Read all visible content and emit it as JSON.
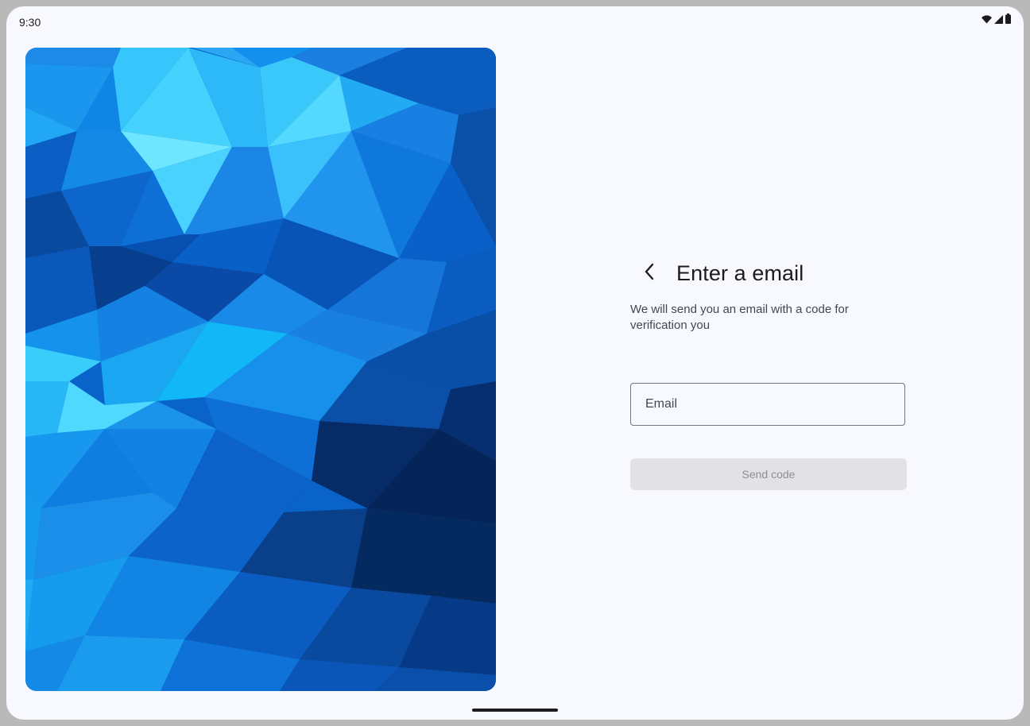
{
  "status_bar": {
    "time": "9:30",
    "icons": [
      "wifi-icon",
      "cell-signal-icon",
      "battery-icon"
    ]
  },
  "hero": {
    "description_icon": "blue-polygon-artwork"
  },
  "form": {
    "back_icon": "chevron-left-icon",
    "title": "Enter a email",
    "subtitle": "We will send you an email with a code for verification you",
    "email": {
      "placeholder": "Email",
      "value": ""
    },
    "send_button_label": "Send code",
    "send_button_enabled": false
  },
  "colors": {
    "background": "#f8f9fe",
    "text_primary": "#1c1b1f",
    "text_secondary": "#44474f",
    "outline": "#74777f",
    "disabled_button": "#e2e2e6",
    "disabled_text": "#8e8f94"
  }
}
